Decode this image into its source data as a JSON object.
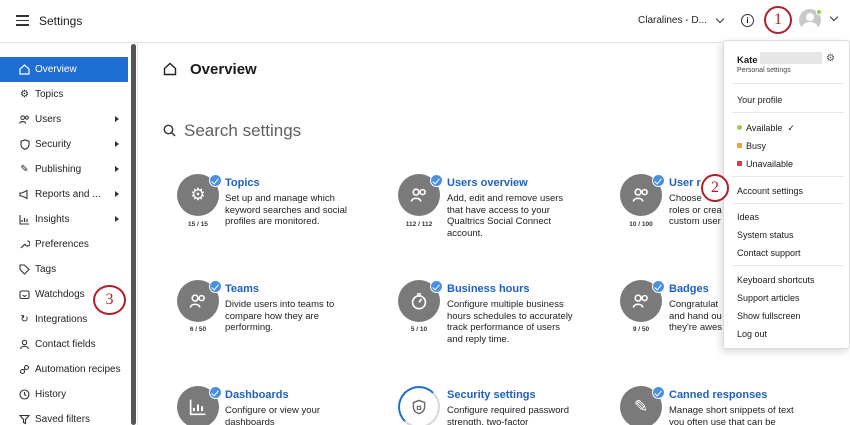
{
  "header": {
    "title": "Settings",
    "brand": "Claralines - D...",
    "info_icon": "info-icon",
    "avatar_status_color": "#8fd14f"
  },
  "sidebar": {
    "items": [
      {
        "label": "Overview",
        "icon": "home-icon",
        "active": true,
        "submenu": false
      },
      {
        "label": "Topics",
        "icon": "gear-icon",
        "submenu": false
      },
      {
        "label": "Users",
        "icon": "users-icon",
        "submenu": true
      },
      {
        "label": "Security",
        "icon": "shield-icon",
        "submenu": true
      },
      {
        "label": "Publishing",
        "icon": "edit-icon",
        "submenu": true
      },
      {
        "label": "Reports and ...",
        "icon": "megaphone-icon",
        "submenu": true
      },
      {
        "label": "Insights",
        "icon": "chart-icon",
        "submenu": true
      },
      {
        "label": "Preferences",
        "icon": "wrench-icon",
        "submenu": false
      },
      {
        "label": "Tags",
        "icon": "tag-icon",
        "submenu": false
      },
      {
        "label": "Watchdogs",
        "icon": "dog-icon",
        "submenu": false
      },
      {
        "label": "Integrations",
        "icon": "refresh-icon",
        "submenu": false
      },
      {
        "label": "Contact fields",
        "icon": "person-icon",
        "submenu": false
      },
      {
        "label": "Automation recipes",
        "icon": "link-icon",
        "submenu": false
      },
      {
        "label": "History",
        "icon": "clock-icon",
        "submenu": false
      },
      {
        "label": "Saved filters",
        "icon": "filter-icon",
        "submenu": false
      }
    ]
  },
  "main": {
    "title": "Overview",
    "search_placeholder": "Search settings",
    "cards": [
      {
        "title": "Topics",
        "desc": [
          "Set up and manage which",
          "keyword searches and social",
          "profiles are monitored."
        ],
        "count": "15 / 15",
        "icon": "gear-icon"
      },
      {
        "title": "Users overview",
        "desc": [
          "Add, edit and remove users",
          "that have access to your",
          "Qualtrics Social Connect",
          "account."
        ],
        "count": "112 / 112",
        "icon": "users-icon"
      },
      {
        "title": "User r",
        "desc": [
          "Choose",
          "roles or crea",
          "custom user"
        ],
        "count": "10 / 100",
        "icon": "users-icon"
      },
      {
        "title": "Teams",
        "desc": [
          "Divide users into teams to",
          "compare how they are",
          "performing."
        ],
        "count": "6 / 50",
        "icon": "users-icon"
      },
      {
        "title": "Business hours",
        "desc": [
          "Configure multiple business",
          "hours schedules to accurately",
          "track performance of users",
          "and reply time."
        ],
        "count": "5 / 10",
        "icon": "stopwatch-icon"
      },
      {
        "title": "Badges",
        "desc": [
          "Congratulat",
          "and hand ou",
          "they're awes"
        ],
        "count": "9 / 50",
        "icon": "users-icon"
      },
      {
        "title": "Dashboards",
        "desc": [
          "Configure or view your",
          "dashboards"
        ],
        "count": "",
        "icon": "chart-icon"
      },
      {
        "title": "Security settings",
        "desc": [
          "Configure required password",
          "strength, two-factor"
        ],
        "count": "",
        "icon": "shield-icon"
      },
      {
        "title": "Canned responses",
        "desc": [
          "Manage short snippets of text",
          "you often use that can be"
        ],
        "count": "",
        "icon": "edit-icon"
      }
    ]
  },
  "menu": {
    "user_name": "Kate",
    "personal_settings": "Personal settings",
    "your_profile": "Your profile",
    "statuses": [
      {
        "label": "Available",
        "color": "#8fd14f",
        "checked": true
      },
      {
        "label": "Busy",
        "color": "#f5a623"
      },
      {
        "label": "Unavailable",
        "color": "#e0393e"
      }
    ],
    "account_settings": "Account settings",
    "links_1": [
      "Ideas",
      "System status",
      "Contact support"
    ],
    "links_2": [
      "Keyboard shortcuts",
      "Support articles",
      "Show fullscreen",
      "Log out"
    ]
  },
  "callouts": [
    "1",
    "2",
    "3"
  ]
}
